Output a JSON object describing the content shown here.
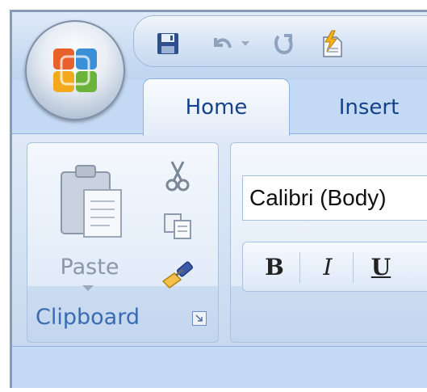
{
  "quick_access": {
    "icons": [
      "office-button-icon",
      "save-icon",
      "undo-icon",
      "undo-dropdown-icon",
      "redo-icon",
      "format-painter-icon"
    ]
  },
  "tabs": [
    {
      "label": "Home",
      "active": true
    },
    {
      "label": "Insert",
      "active": false
    }
  ],
  "clipboard_group": {
    "label": "Clipboard",
    "paste_label": "Paste",
    "tools": [
      "cut-icon",
      "copy-icon",
      "format-painter-icon"
    ]
  },
  "font_group": {
    "font_name": "Calibri (Body)",
    "format_buttons": [
      {
        "label": "B",
        "name": "bold"
      },
      {
        "label": "I",
        "name": "italic"
      },
      {
        "label": "U",
        "name": "underline"
      }
    ]
  },
  "colors": {
    "tab_text": "#15428b",
    "group_label": "#3a6bb0",
    "ribbon_bg": "#d2e1f3",
    "frame_bg": "#c4d9f3"
  }
}
